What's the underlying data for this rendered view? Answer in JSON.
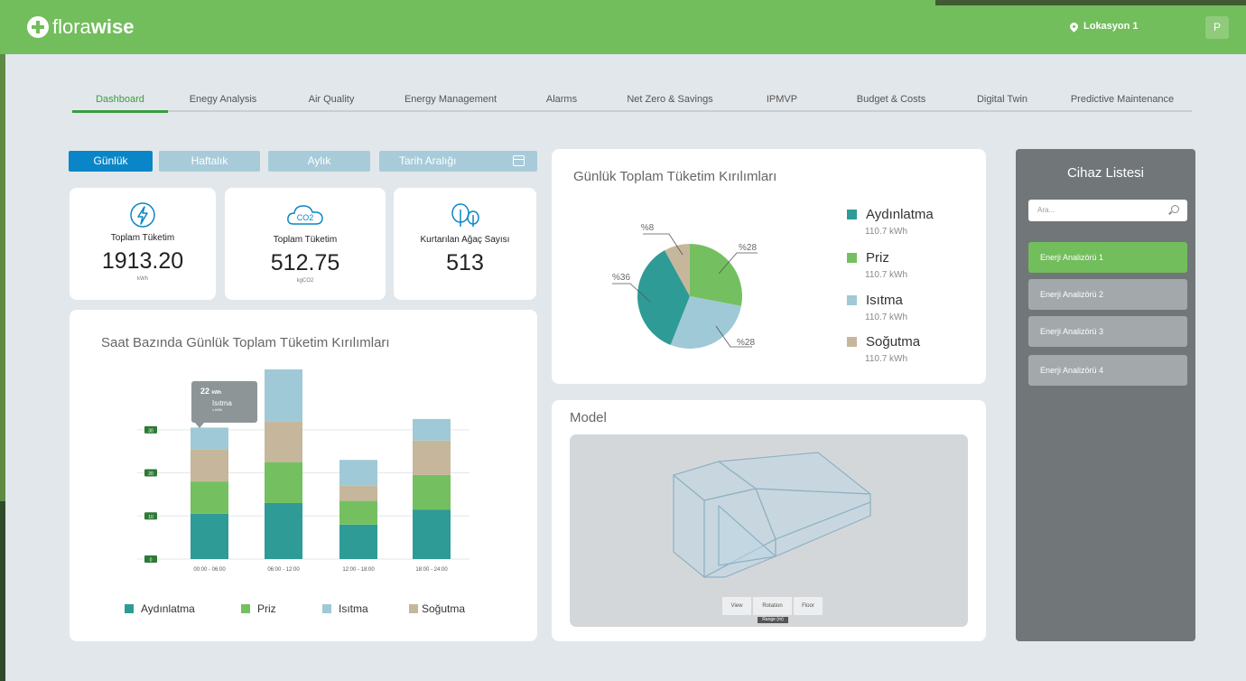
{
  "app": {
    "logo_part1": "flora",
    "logo_part2": "wise"
  },
  "header": {
    "location": "Lokasyon 1",
    "avatar_initial": "P"
  },
  "nav": {
    "items": [
      "Dashboard",
      "Enegy Analysis",
      "Air Quality",
      "Energy Management",
      "Alarms",
      "Net Zero & Savings",
      "IPMVP",
      "Budget & Costs",
      "Digital Twin",
      "Predictive Maintenance"
    ],
    "active_index": 0
  },
  "period": {
    "daily": "Günlük",
    "weekly": "Haftalık",
    "monthly": "Aylık",
    "range": "Tarih Aralığı"
  },
  "kpis": [
    {
      "label": "Toplam Tüketim",
      "value": "1913.20",
      "unit": "kWh",
      "icon": "lightning-icon"
    },
    {
      "label": "Toplam Tüketim",
      "value": "512.75",
      "unit": "kgCO2",
      "icon": "co2-cloud-icon",
      "icon_text": "CO2"
    },
    {
      "label": "Kurtarılan Ağaç Sayısı",
      "value": "513",
      "unit": "",
      "icon": "trees-icon"
    }
  ],
  "hourly_chart": {
    "title": "Saat Bazında Günlük Toplam Tüketim Kırılımları",
    "tooltip": {
      "value": "22",
      "unit": "kWh",
      "series": "Isıtma",
      "sub": "x kWh"
    }
  },
  "pie_card": {
    "title": "Günlük Toplam Tüketim Kırılımları",
    "legend": [
      {
        "name": "Aydınlatma",
        "value": "110.7 kWh"
      },
      {
        "name": "Priz",
        "value": "110.7 kWh"
      },
      {
        "name": "Isıtma",
        "value": "110.7 kWh"
      },
      {
        "name": "Soğutma",
        "value": "110.7 kWh"
      }
    ]
  },
  "model": {
    "title": "Model",
    "buttons": [
      "View",
      "Rotation",
      "Floor"
    ],
    "tag": "Range (m)"
  },
  "devices": {
    "title": "Cihaz Listesi",
    "search_placeholder": "Ara...",
    "items": [
      "Enerji Analizörü 1",
      "Enerji Analizörü 2",
      "Enerji Analizörü 3",
      "Enerji Analizörü 4"
    ],
    "active_index": 0
  },
  "colors": {
    "brand_green": "#72bd5c",
    "aydinlatma": "#2e9b96",
    "priz": "#74c060",
    "isitma": "#9fc9d7",
    "sogutma": "#c6b79c",
    "period_active": "#0a86c8"
  },
  "chart_data": [
    {
      "type": "bar",
      "stacked": true,
      "title": "Saat Bazında Günlük Toplam Tüketim Kırılımları",
      "categories": [
        "00:00 - 06:00",
        "06:00 - 12:00",
        "12:00 - 18:00",
        "18:00 - 24:00"
      ],
      "series": [
        {
          "name": "Aydınlatma",
          "values": [
            10.5,
            13,
            8,
            11.5
          ]
        },
        {
          "name": "Priz",
          "values": [
            7.5,
            9.5,
            5.5,
            8
          ]
        },
        {
          "name": "Soğutma",
          "values": [
            7.5,
            9.5,
            3.5,
            8
          ]
        },
        {
          "name": "Isıtma",
          "values": [
            5,
            12,
            6,
            5
          ]
        }
      ],
      "yticks": [
        0,
        10,
        20,
        30
      ],
      "ylim": [
        0,
        44
      ],
      "legend": [
        "Aydınlatma",
        "Priz",
        "Isıtma",
        "Soğutma"
      ],
      "legend_position": "bottom"
    },
    {
      "type": "pie",
      "title": "Günlük Toplam Tüketim Kırılımları",
      "labels": [
        "Priz",
        "Isıtma",
        "Aydınlatma",
        "Soğutma"
      ],
      "values": [
        28,
        28,
        36,
        8
      ],
      "value_labels": [
        "%28",
        "%28",
        "%36",
        "%8"
      ],
      "legend_position": "right"
    }
  ]
}
